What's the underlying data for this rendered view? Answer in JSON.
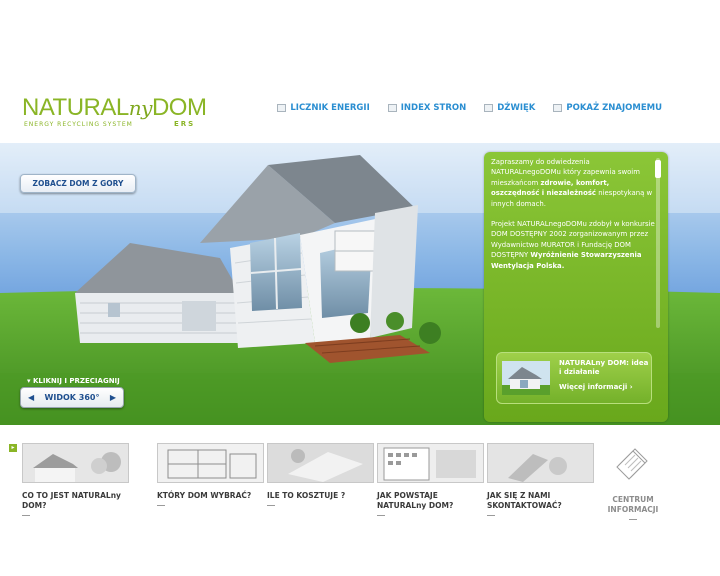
{
  "logo": {
    "main_left": "NATURAL",
    "main_mid": "ny",
    "main_right": "DOM",
    "tagline": "ENERGY RECYCLING SYSTEM",
    "ers": "ERS"
  },
  "topnav": [
    {
      "label": "LICZNIK ENERGII",
      "icon": "counter-icon"
    },
    {
      "label": "INDEX STRON",
      "icon": "index-icon"
    },
    {
      "label": "DŹWIĘK",
      "icon": "sound-icon"
    },
    {
      "label": "POKAŻ ZNAJOMEMU",
      "icon": "share-icon"
    }
  ],
  "hero": {
    "top_button": "ZOBACZ DOM Z GORY",
    "drag_hint": "▾ KLIKNIJ I PRZECIAGNIJ",
    "view_button": "WIDOK 360°",
    "arrow_left": "◀",
    "arrow_right": "▶"
  },
  "panel": {
    "p1_a": "Zapraszamy do odwiedzenia NATURALnegoDOMu który zapewnia swoim mieszkańcom ",
    "p1_b": "zdrowie, komfort, oszczędność i niezależność",
    "p1_c": " niespotykaną w innych domach.",
    "p2_a": "Projekt NATURALnegoDOMu zdobył w konkursie DOM DOSTĘPNY 2002 zorganizowanym przez Wydawnictwo MURATOR i Fundację DOM DOSTĘPNY ",
    "p2_b": "Wyróżnienie Stowarzyszenia Wentylacja Polska.",
    "promo_title": "NATURALny DOM: idea i działanie",
    "promo_link": "Więcej informacji ›"
  },
  "tiles": [
    {
      "label": "CO TO JEST NATURALny DOM?"
    },
    {
      "label": "KTÓRY DOM WYBRAĆ?"
    },
    {
      "label": "ILE TO KOSZTUJE ?"
    },
    {
      "label": "JAK POWSTAJE NATURALny DOM?"
    },
    {
      "label": "JAK SIĘ Z NAMI SKONTAKTOWAĆ?"
    }
  ],
  "centrum": {
    "label": "CENTRUM INFORMACJI"
  },
  "colors": {
    "brand_green": "#8ab526",
    "nav_blue": "#2a8ed1",
    "panel_green": "#78b52a"
  }
}
